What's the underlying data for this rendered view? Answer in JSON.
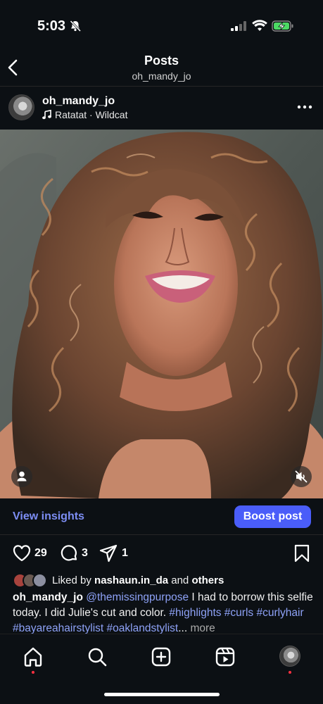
{
  "status_bar": {
    "time": "5:03"
  },
  "header": {
    "title": "Posts",
    "subtitle": "oh_mandy_jo"
  },
  "post": {
    "username": "oh_mandy_jo",
    "song": "Ratatat · Wildcat"
  },
  "insights": {
    "view_label": "View insights",
    "boost_label": "Boost post"
  },
  "actions": {
    "likes": "29",
    "comments": "3",
    "shares": "1"
  },
  "likes": {
    "prefix": "Liked by ",
    "user": "nashaun.in_da",
    "middle": " and ",
    "others": "others"
  },
  "caption": {
    "username": "oh_mandy_jo",
    "mention": "@themissingpurpose",
    "text": " I had to borrow this selfie today. I did Julie's cut and color. ",
    "hashtags": "#highlights #curls #curlyhair #bayareahairstylist #oaklandstylist",
    "ellipsis": "...",
    "more": "more"
  },
  "colors": {
    "background": "#0c1014",
    "accent_link": "#7d8ef5",
    "boost_button": "#4a5df9",
    "notification_dot": "#ff3040",
    "battery_green": "#4cd964"
  },
  "icons": {
    "status": [
      "bell-slash-icon",
      "cellular-signal-icon",
      "wifi-icon",
      "battery-charging-icon"
    ],
    "nav": [
      "home-icon",
      "search-icon",
      "create-post-icon",
      "reels-icon",
      "profile-avatar"
    ]
  }
}
